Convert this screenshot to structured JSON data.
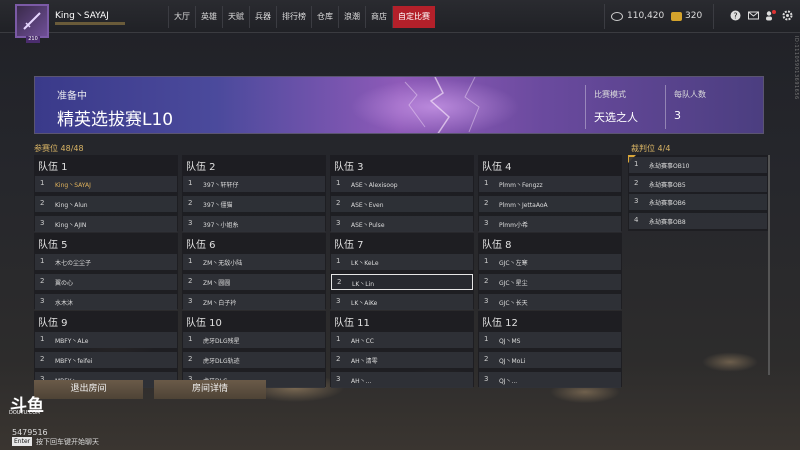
{
  "player": {
    "name": "King丶SAYAJ",
    "level": "210"
  },
  "nav": [
    "大厅",
    "英雄",
    "天赋",
    "兵器",
    "排行榜",
    "仓库",
    "浪潮",
    "商店",
    "自定比赛"
  ],
  "currency": {
    "coins": "110,420",
    "gold": "320"
  },
  "meta_vertical": "ID:111059013691656",
  "banner": {
    "status": "准备中",
    "title": "精英选拔赛L10",
    "mode_label": "比赛模式",
    "mode_value": "天选之人",
    "count_label": "每队人数",
    "count_value": "3"
  },
  "slots_label": "参赛位 48/48",
  "referee_label": "裁判位 4/4",
  "teams": [
    {
      "name": "队伍 1",
      "players": [
        "King丶SAYAJ",
        "King丶Alun",
        "King丶AJIN"
      ]
    },
    {
      "name": "队伍 2",
      "players": [
        "397丶轩轩仔",
        "397丶僵猫",
        "397丶小姐糸"
      ]
    },
    {
      "name": "队伍 3",
      "players": [
        "ASE丶Alexisoop",
        "ASE丶Even",
        "ASE丶Pulse"
      ]
    },
    {
      "name": "队伍 4",
      "players": [
        "Plmm丶Fengzz",
        "Plmm丶JettaAoA",
        "Plmm小希"
      ]
    },
    {
      "name": "队伍 5",
      "players": [
        "木七の尘尘子",
        "翼の心",
        "水木沐"
      ]
    },
    {
      "name": "队伍 6",
      "players": [
        "ZM丶无敌小陆",
        "ZM丶圆圆",
        "ZM丶白子衿"
      ]
    },
    {
      "name": "队伍 7",
      "players": [
        "LK丶KeLe",
        "LK丶Lin",
        "LK丶AiKe"
      ]
    },
    {
      "name": "队伍 8",
      "players": [
        "GJC丶左寒",
        "GJC丶星尘",
        "GJC丶长天"
      ]
    },
    {
      "name": "队伍 9",
      "players": [
        "MBFY丶ALe",
        "MBFY丶feifei",
        "MBFY丶..."
      ]
    },
    {
      "name": "队伍 10",
      "players": [
        "虎牙DLG残星",
        "虎牙DLG轨迹",
        "虎牙DLG..."
      ]
    },
    {
      "name": "队伍 11",
      "players": [
        "AH丶CC",
        "AH丶清零",
        "AH丶..."
      ]
    },
    {
      "name": "队伍 12",
      "players": [
        "QJ丶MS",
        "QJ丶MoLi",
        "QJ丶..."
      ]
    }
  ],
  "referees": [
    "永劫赛事OB10",
    "永劫赛事OB5",
    "永劫赛事OB6",
    "永劫赛事OB8"
  ],
  "buttons": {
    "leave": "退出房间",
    "detail": "房间详情"
  },
  "overlay": {
    "logo": "斗鱼",
    "logo_sub": "DOUYU.COM",
    "room_id": "5479516",
    "enter": "Enter",
    "chat_hint": "按下回车键开始聊天"
  },
  "colors": {
    "accent": "#b3202a",
    "gold": "#d9b464",
    "banner_purple": "#8e5ab8"
  }
}
